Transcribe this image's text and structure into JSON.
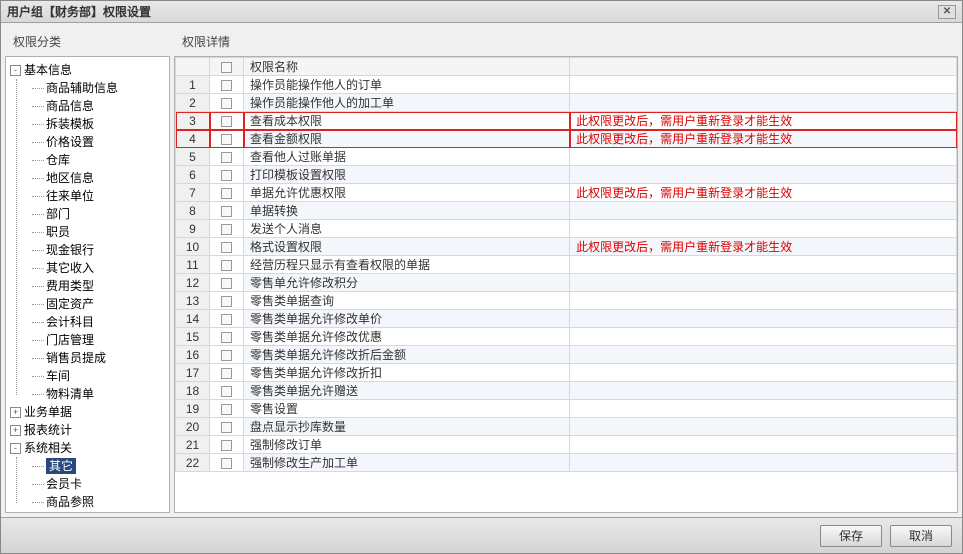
{
  "window": {
    "title": "用户组【财务部】权限设置"
  },
  "left": {
    "header": "权限分类",
    "tree": [
      {
        "label": "基本信息",
        "toggle": "-",
        "children": [
          "商品辅助信息",
          "商品信息",
          "拆装模板",
          "价格设置",
          "仓库",
          "地区信息",
          "往来单位",
          "部门",
          "职员",
          "现金银行",
          "其它收入",
          "费用类型",
          "固定资产",
          "会计科目",
          "门店管理",
          "销售员提成",
          "车间",
          "物料清单"
        ]
      },
      {
        "label": "业务单据",
        "toggle": "+"
      },
      {
        "label": "报表统计",
        "toggle": "+"
      },
      {
        "label": "系统相关",
        "toggle": "-",
        "children": [
          "其它",
          "会员卡",
          "商品参照"
        ],
        "selectedChild": "其它"
      }
    ]
  },
  "right": {
    "header": "权限详情",
    "columns": {
      "name": "权限名称"
    },
    "hint": "此权限更改后，需用户重新登录才能生效",
    "rows": [
      {
        "n": 1,
        "name": "操作员能操作他人的订单"
      },
      {
        "n": 2,
        "name": "操作员能操作他人的加工单"
      },
      {
        "n": 3,
        "name": "查看成本权限",
        "note": true,
        "hl": true
      },
      {
        "n": 4,
        "name": "查看金额权限",
        "note": true,
        "hl": true
      },
      {
        "n": 5,
        "name": "查看他人过账单据"
      },
      {
        "n": 6,
        "name": "打印模板设置权限"
      },
      {
        "n": 7,
        "name": "单据允许优惠权限",
        "note": true
      },
      {
        "n": 8,
        "name": "单据转换"
      },
      {
        "n": 9,
        "name": "发送个人消息"
      },
      {
        "n": 10,
        "name": "格式设置权限",
        "note": true
      },
      {
        "n": 11,
        "name": "经营历程只显示有查看权限的单据"
      },
      {
        "n": 12,
        "name": "零售单允许修改积分"
      },
      {
        "n": 13,
        "name": "零售类单据查询"
      },
      {
        "n": 14,
        "name": "零售类单据允许修改单价"
      },
      {
        "n": 15,
        "name": "零售类单据允许修改优惠"
      },
      {
        "n": 16,
        "name": "零售类单据允许修改折后金额"
      },
      {
        "n": 17,
        "name": "零售类单据允许修改折扣"
      },
      {
        "n": 18,
        "name": "零售类单据允许赠送"
      },
      {
        "n": 19,
        "name": "零售设置"
      },
      {
        "n": 20,
        "name": "盘点显示抄库数量"
      },
      {
        "n": 21,
        "name": "强制修改订单"
      },
      {
        "n": 22,
        "name": "强制修改生产加工单"
      }
    ]
  },
  "footer": {
    "save": "保存",
    "cancel": "取消"
  }
}
